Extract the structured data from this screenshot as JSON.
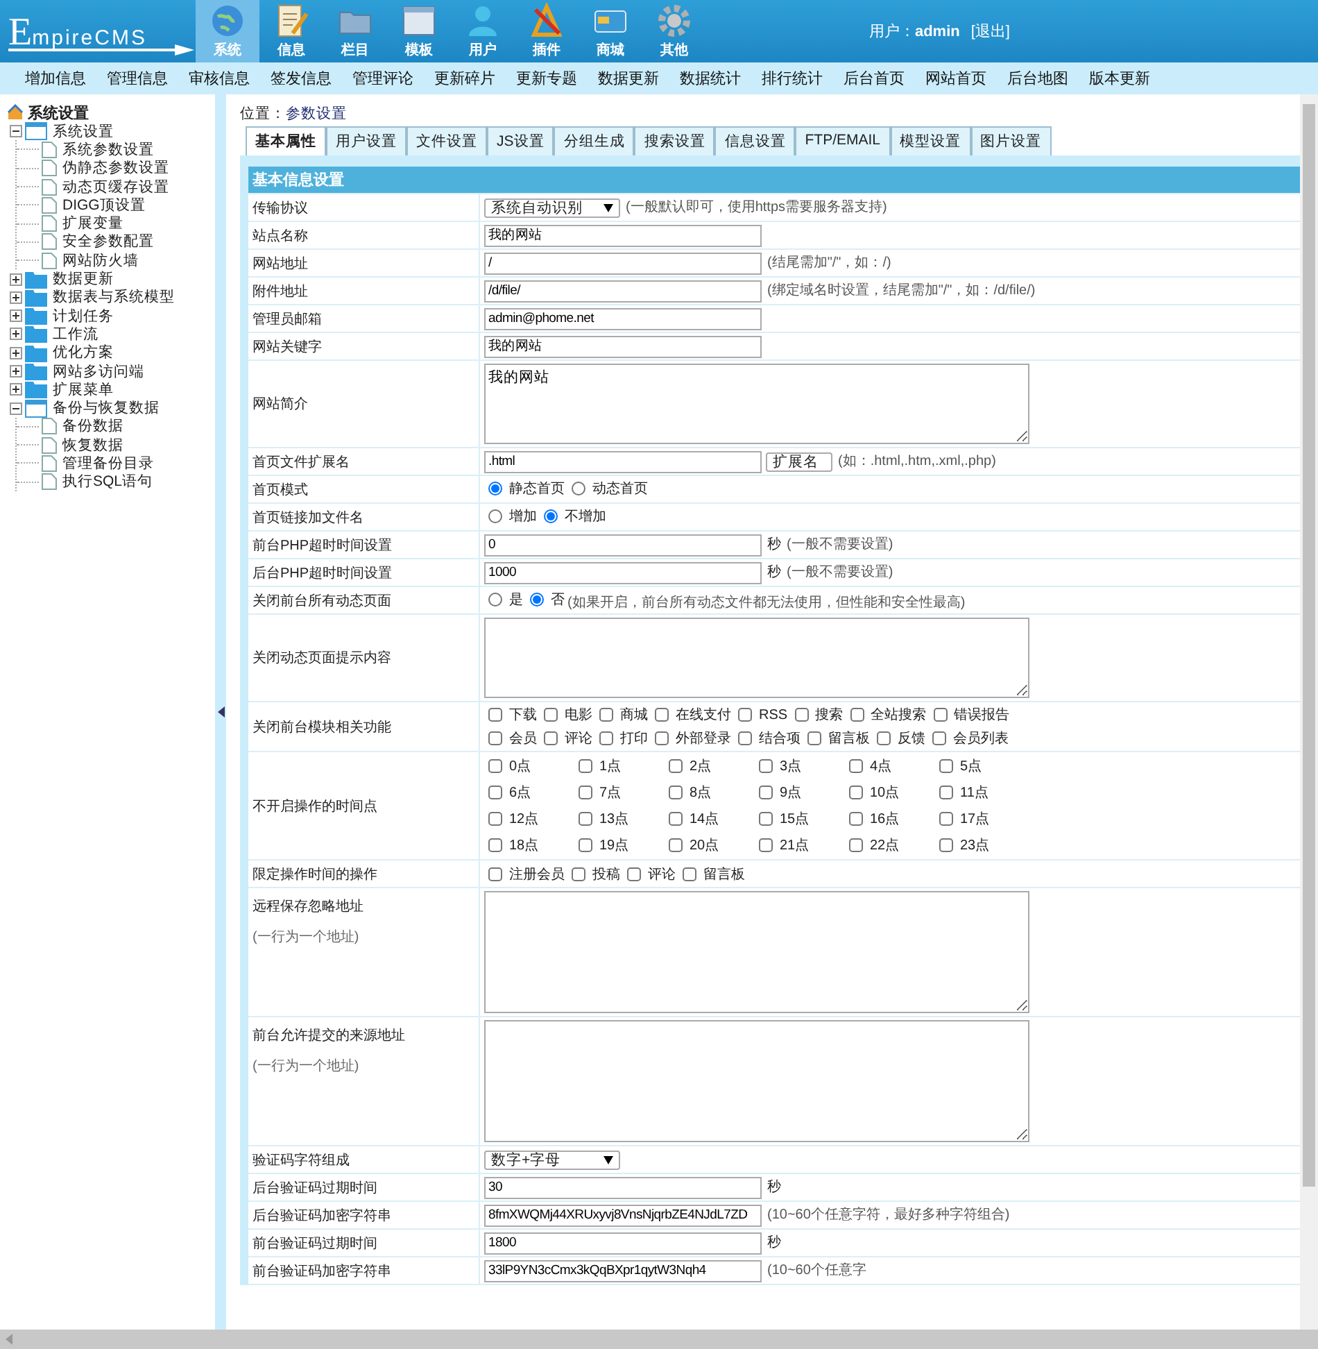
{
  "header": {
    "logo": "EmpireCMS",
    "user_label": "用户：",
    "user_name": "admin",
    "logout": "[退出]"
  },
  "nav": [
    {
      "label": "系统",
      "selected": true
    },
    {
      "label": "信息",
      "selected": false
    },
    {
      "label": "栏目",
      "selected": false
    },
    {
      "label": "模板",
      "selected": false
    },
    {
      "label": "用户",
      "selected": false
    },
    {
      "label": "插件",
      "selected": false
    },
    {
      "label": "商城",
      "selected": false
    },
    {
      "label": "其他",
      "selected": false
    }
  ],
  "menu": [
    "增加信息",
    "管理信息",
    "审核信息",
    "签发信息",
    "管理评论",
    "更新碎片",
    "更新专题",
    "数据更新",
    "数据统计",
    "排行统计",
    "后台首页",
    "网站首页",
    "后台地图",
    "版本更新"
  ],
  "sidebar": {
    "title": "系统设置",
    "items": [
      {
        "label": "系统设置",
        "expanded": true,
        "children": [
          {
            "label": "系统参数设置"
          },
          {
            "label": "伪静态参数设置"
          },
          {
            "label": "动态页缓存设置"
          },
          {
            "label": "DIGG顶设置"
          },
          {
            "label": "扩展变量"
          },
          {
            "label": "安全参数配置"
          },
          {
            "label": "网站防火墙"
          }
        ]
      },
      {
        "label": "数据更新",
        "expanded": false
      },
      {
        "label": "数据表与系统模型",
        "expanded": false
      },
      {
        "label": "计划任务",
        "expanded": false
      },
      {
        "label": "工作流",
        "expanded": false
      },
      {
        "label": "优化方案",
        "expanded": false
      },
      {
        "label": "网站多访问端",
        "expanded": false
      },
      {
        "label": "扩展菜单",
        "expanded": false
      },
      {
        "label": "备份与恢复数据",
        "expanded": true,
        "children": [
          {
            "label": "备份数据"
          },
          {
            "label": "恢复数据"
          },
          {
            "label": "管理备份目录"
          },
          {
            "label": "执行SQL语句"
          }
        ]
      }
    ]
  },
  "location": {
    "label": "位置：",
    "link": "参数设置"
  },
  "tabs": [
    {
      "label": "基本属性",
      "selected": true
    },
    {
      "label": "用户设置",
      "selected": false
    },
    {
      "label": "文件设置",
      "selected": false
    },
    {
      "label": "JS设置",
      "selected": false
    },
    {
      "label": "分组生成",
      "selected": false
    },
    {
      "label": "搜索设置",
      "selected": false
    },
    {
      "label": "信息设置",
      "selected": false
    },
    {
      "label": "FTP/EMAIL",
      "selected": false
    },
    {
      "label": "模型设置",
      "selected": false
    },
    {
      "label": "图片设置",
      "selected": false
    }
  ],
  "section_title": "基本信息设置",
  "rows": [
    {
      "kind": "select",
      "label": "传输协议",
      "value": "系统自动识别",
      "note": "(一般默认即可，使用https需要服务器支持)"
    },
    {
      "kind": "text",
      "label": "站点名称",
      "value": "我的网站"
    },
    {
      "kind": "text",
      "label": "网站地址",
      "value": "/",
      "note": "(结尾需加\"/\"，如：/)"
    },
    {
      "kind": "text",
      "label": "附件地址",
      "value": "/d/file/",
      "note": "(绑定域名时设置，结尾需加\"/\"，如：/d/file/)"
    },
    {
      "kind": "text",
      "label": "管理员邮箱",
      "value": "admin@phome.net"
    },
    {
      "kind": "text",
      "label": "网站关键字",
      "value": "我的网站"
    },
    {
      "kind": "textarea",
      "label": "网站简介",
      "value": "我的网站"
    },
    {
      "kind": "text_select",
      "label": "首页文件扩展名",
      "value": ".html",
      "select": "扩展名",
      "note": "(如：.html,.htm,.xml,.php)"
    },
    {
      "kind": "radio",
      "label": "首页模式",
      "options": [
        {
          "label": "静态首页",
          "selected": true
        },
        {
          "label": "动态首页",
          "selected": false
        }
      ]
    },
    {
      "kind": "radio",
      "label": "首页链接加文件名",
      "options": [
        {
          "label": "增加",
          "selected": false
        },
        {
          "label": "不增加",
          "selected": true
        }
      ]
    },
    {
      "kind": "text",
      "label": "前台PHP超时时间设置",
      "value": "0",
      "unit": "秒",
      "note": "(一般不需要设置)"
    },
    {
      "kind": "text",
      "label": "后台PHP超时时间设置",
      "value": "1000",
      "unit": "秒",
      "note": "(一般不需要设置)"
    },
    {
      "kind": "radio",
      "label": "关闭前台所有动态页面",
      "options": [
        {
          "label": "是",
          "selected": false
        },
        {
          "label": "否",
          "selected": true
        }
      ],
      "note": "(如果开启，前台所有动态文件都无法使用，但性能和安全性最高)"
    },
    {
      "kind": "textarea",
      "label": "关闭动态页面提示内容"
    },
    {
      "kind": "checks",
      "label": "关闭前台模块相关功能",
      "options": [
        {
          "label": "下载",
          "checked": false
        },
        {
          "label": "电影",
          "checked": false
        },
        {
          "label": "商城",
          "checked": false
        },
        {
          "label": "在线支付",
          "checked": false
        },
        {
          "label": "RSS",
          "checked": false
        },
        {
          "label": "搜索",
          "checked": false
        },
        {
          "label": "全站搜索",
          "checked": false
        },
        {
          "label": "错误报告",
          "checked": false
        },
        {
          "label": "会员",
          "checked": false
        },
        {
          "label": "评论",
          "checked": false
        },
        {
          "label": "打印",
          "checked": false
        },
        {
          "label": "外部登录",
          "checked": false
        },
        {
          "label": "结合项",
          "checked": false
        },
        {
          "label": "留言板",
          "checked": false
        },
        {
          "label": "反馈",
          "checked": false
        },
        {
          "label": "会员列表",
          "checked": false
        }
      ]
    },
    {
      "kind": "grid",
      "label": "不开启操作的时间点",
      "options": [
        {
          "label": "0点",
          "checked": false
        },
        {
          "label": "1点",
          "checked": false
        },
        {
          "label": "2点",
          "checked": false
        },
        {
          "label": "3点",
          "checked": false
        },
        {
          "label": "4点",
          "checked": false
        },
        {
          "label": "5点",
          "checked": false
        },
        {
          "label": "6点",
          "checked": false
        },
        {
          "label": "7点",
          "checked": false
        },
        {
          "label": "8点",
          "checked": false
        },
        {
          "label": "9点",
          "checked": false
        },
        {
          "label": "10点",
          "checked": false
        },
        {
          "label": "11点",
          "checked": false
        },
        {
          "label": "12点",
          "checked": false
        },
        {
          "label": "13点",
          "checked": false
        },
        {
          "label": "14点",
          "checked": false
        },
        {
          "label": "15点",
          "checked": false
        },
        {
          "label": "16点",
          "checked": false
        },
        {
          "label": "17点",
          "checked": false
        },
        {
          "label": "18点",
          "checked": false
        },
        {
          "label": "19点",
          "checked": false
        },
        {
          "label": "20点",
          "checked": false
        },
        {
          "label": "21点",
          "checked": false
        },
        {
          "label": "22点",
          "checked": false
        },
        {
          "label": "23点",
          "checked": false
        }
      ]
    },
    {
      "kind": "checks",
      "label": "限定操作时间的操作",
      "options": [
        {
          "label": "注册会员",
          "checked": false
        },
        {
          "label": "投稿",
          "checked": false
        },
        {
          "label": "评论",
          "checked": false
        },
        {
          "label": "留言板",
          "checked": false
        }
      ]
    },
    {
      "kind": "bigtext",
      "label": "远程保存忽略地址",
      "hint": "(一行为一个地址)"
    },
    {
      "kind": "bigtext",
      "label": "前台允许提交的来源地址",
      "hint": "(一行为一个地址)"
    },
    {
      "kind": "select",
      "label": "验证码字符组成",
      "value": "数字+字母"
    },
    {
      "kind": "text",
      "label": "后台验证码过期时间",
      "value": "30",
      "unit": "秒"
    },
    {
      "kind": "text",
      "label": "后台验证码加密字符串",
      "value": "8fmXWQMj44XRUxyvj8VnsNjqrbZE4NJdL7ZD",
      "note": "(10~60个任意字符，最好多种字符组合)"
    },
    {
      "kind": "text",
      "label": "前台验证码过期时间",
      "value": "1800",
      "unit": "秒"
    },
    {
      "kind": "text",
      "label": "前台验证码加密字符串",
      "value": "33lP9YN3cCmx3kQqBXpr1qytW3Nqh4",
      "note": "(10~60个任意字"
    }
  ]
}
